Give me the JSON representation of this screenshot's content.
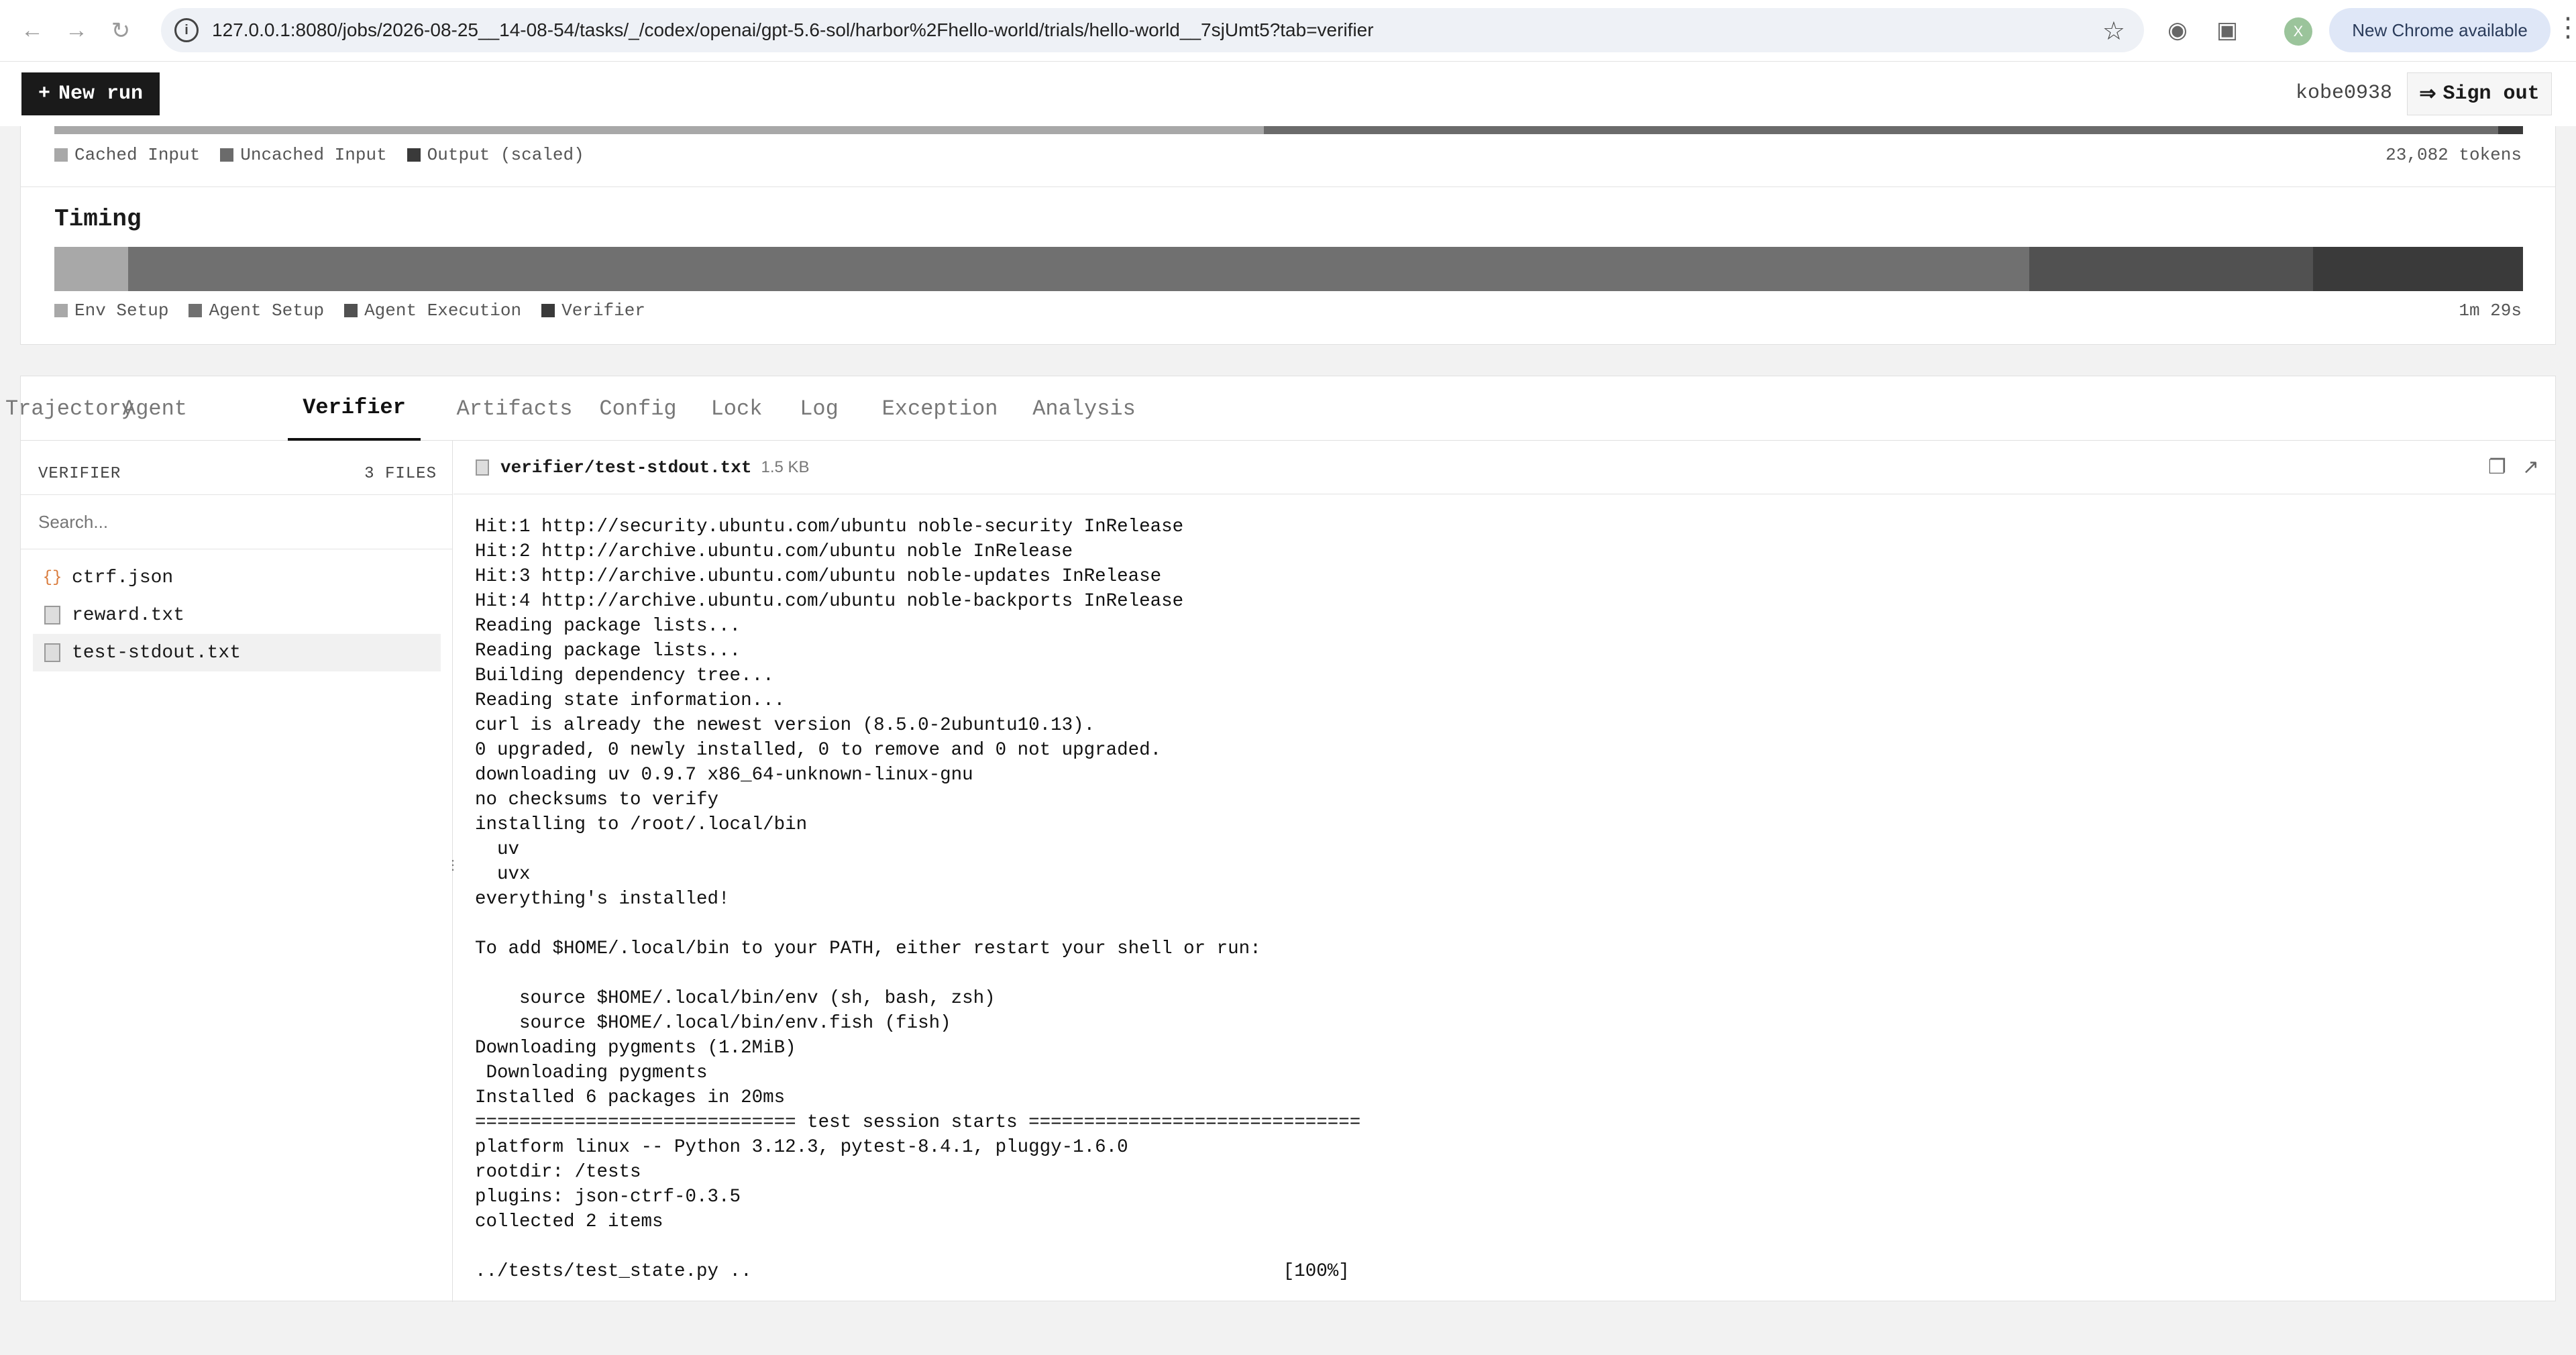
{
  "browser": {
    "url": "127.0.0.1:8080/jobs/2026-08-25__14-08-54/tasks/_/codex/openai/gpt-5.6-sol/harbor%2Fhello-world/trials/hello-world__7sjUmt5?tab=verifier",
    "profile_initial": "X",
    "update_label": "New Chrome available"
  },
  "header": {
    "new_run_label": "New run",
    "username": "kobe0938",
    "sign_out_label": "Sign out"
  },
  "tokens": {
    "legend": [
      "Cached Input",
      "Uncached Input",
      "Output (scaled)"
    ],
    "total_label": "23,082 tokens",
    "segments": [
      {
        "name": "Cached Input",
        "fraction": 0.49,
        "color": "#a8a8a8"
      },
      {
        "name": "Uncached Input",
        "fraction": 0.5,
        "color": "#6b6b6b"
      },
      {
        "name": "Output (scaled)",
        "fraction": 0.01,
        "color": "#3a3a3a"
      }
    ]
  },
  "timing": {
    "title": "Timing",
    "legend": [
      "Env Setup",
      "Agent Setup",
      "Agent Execution",
      "Verifier"
    ],
    "total_label": "1m 29s",
    "segments": [
      {
        "name": "Env Setup",
        "fraction": 0.03,
        "color": "#a8a8a8"
      },
      {
        "name": "Agent Setup",
        "fraction": 0.77,
        "color": "#707070"
      },
      {
        "name": "Agent Execution",
        "fraction": 0.115,
        "color": "#515151"
      },
      {
        "name": "Verifier",
        "fraction": 0.085,
        "color": "#3a3a3a"
      }
    ]
  },
  "tabs": [
    "Trajectory",
    "Agent",
    "Verifier",
    "Artifacts",
    "Config",
    "Lock",
    "Log",
    "Exception",
    "Analysis"
  ],
  "active_tab": "Verifier",
  "sidebar": {
    "title": "VERIFIER",
    "count_label": "3 FILES",
    "search_placeholder": "Search...",
    "files": [
      {
        "name": "ctrf.json",
        "icon": "json-braces-icon"
      },
      {
        "name": "reward.txt",
        "icon": "document-icon"
      },
      {
        "name": "test-stdout.txt",
        "icon": "document-icon",
        "active": true
      }
    ]
  },
  "viewer": {
    "filename": "verifier/test-stdout.txt",
    "size": "1.5 KB",
    "content": "Hit:1 http://security.ubuntu.com/ubuntu noble-security InRelease\nHit:2 http://archive.ubuntu.com/ubuntu noble InRelease\nHit:3 http://archive.ubuntu.com/ubuntu noble-updates InRelease\nHit:4 http://archive.ubuntu.com/ubuntu noble-backports InRelease\nReading package lists...\nReading package lists...\nBuilding dependency tree...\nReading state information...\ncurl is already the newest version (8.5.0-2ubuntu10.13).\n0 upgraded, 0 newly installed, 0 to remove and 0 not upgraded.\ndownloading uv 0.9.7 x86_64-unknown-linux-gnu\nno checksums to verify\ninstalling to /root/.local/bin\n  uv\n  uvx\neverything's installed!\n\nTo add $HOME/.local/bin to your PATH, either restart your shell or run:\n\n    source $HOME/.local/bin/env (sh, bash, zsh)\n    source $HOME/.local/bin/env.fish (fish)\nDownloading pygments (1.2MiB)\n Downloading pygments\nInstalled 6 packages in 20ms\n============================= test session starts ==============================\nplatform linux -- Python 3.12.3, pytest-8.4.1, pluggy-1.6.0\nrootdir: /tests\nplugins: json-ctrf-0.3.5\ncollected 2 items\n\n../tests/test_state.py ..                                                [100%]"
  }
}
